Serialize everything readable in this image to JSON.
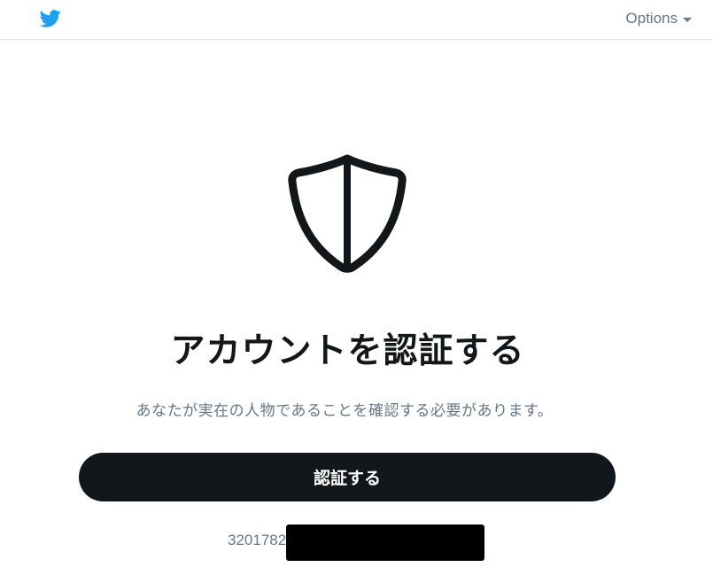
{
  "header": {
    "logo_icon": "twitter-bird-icon",
    "options_label": "Options",
    "options_icon": "caret-down-icon",
    "brand_color": "#1da1f2"
  },
  "main": {
    "icon": "shield-icon",
    "title": "アカウントを認証する",
    "subtitle": "あなたが実在の人物であることを確認する必要があります。",
    "verify_button_label": "認証する",
    "account_id_visible": "3201782"
  },
  "colors": {
    "button_bg": "#12171b",
    "muted_text": "#657786",
    "title_text": "#14171a"
  }
}
